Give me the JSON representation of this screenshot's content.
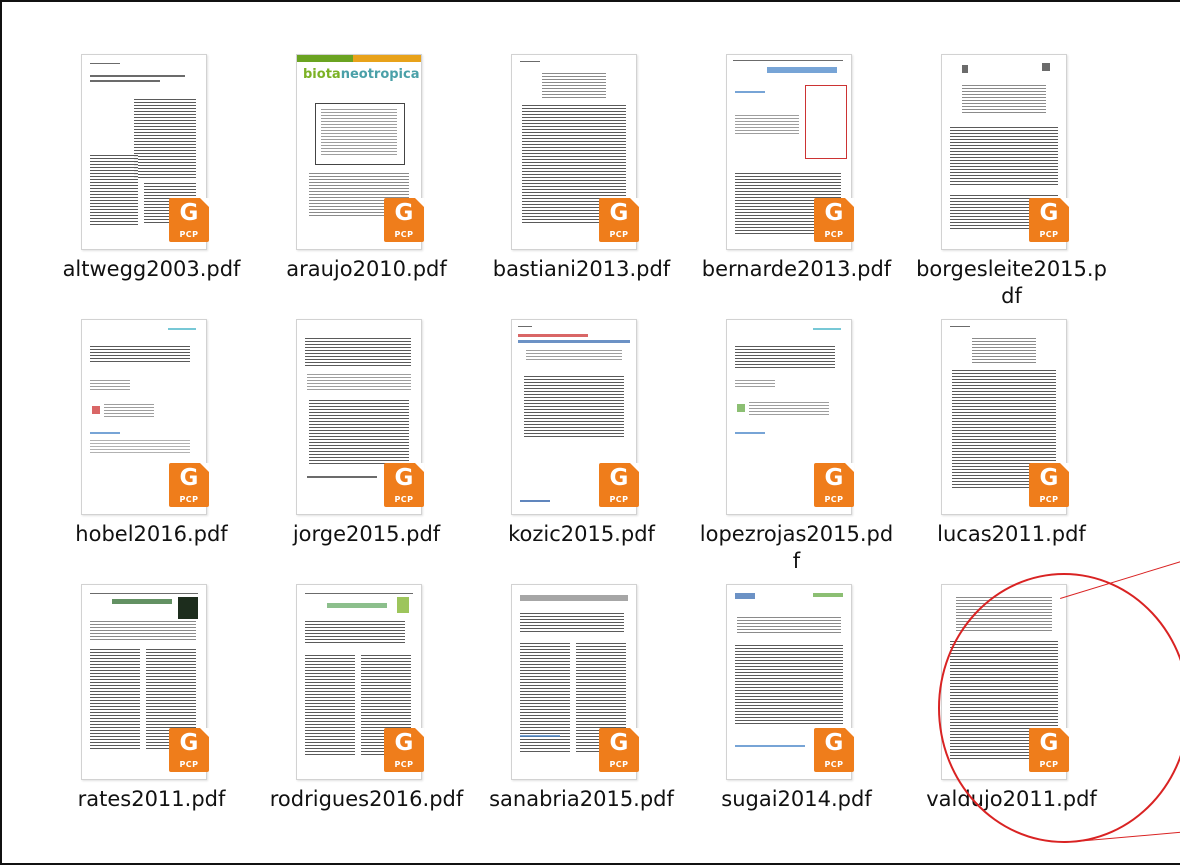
{
  "files": [
    {
      "name": "altwegg2003.pdf",
      "thumb": "a"
    },
    {
      "name": "araujo2010.pdf",
      "thumb": "b"
    },
    {
      "name": "bastiani2013.pdf",
      "thumb": "c"
    },
    {
      "name": "bernarde2013.pdf",
      "thumb": "d"
    },
    {
      "name": "borgesleite2015.pdf",
      "thumb": "e"
    },
    {
      "name": "hobel2016.pdf",
      "thumb": "f"
    },
    {
      "name": "jorge2015.pdf",
      "thumb": "g"
    },
    {
      "name": "kozic2015.pdf",
      "thumb": "h"
    },
    {
      "name": "lopezrojas2015.pdf",
      "thumb": "i"
    },
    {
      "name": "lucas2011.pdf",
      "thumb": "c"
    },
    {
      "name": "rates2011.pdf",
      "thumb": "j"
    },
    {
      "name": "rodrigues2016.pdf",
      "thumb": "k"
    },
    {
      "name": "sanabria2015.pdf",
      "thumb": "l"
    },
    {
      "name": "sugai2014.pdf",
      "thumb": "m"
    },
    {
      "name": "valdujo2011.pdf",
      "thumb": "n"
    }
  ],
  "thumb_text": {
    "biota_part1": "biota",
    "biota_part2": "neotropica"
  },
  "badge": {
    "glyph": "G",
    "label": "PCP",
    "color": "#ef7d1b",
    "icon": "foxit-pdf-file-icon"
  },
  "highlight": {
    "color": "#d92323",
    "target": "valdujo2011.pdf"
  }
}
